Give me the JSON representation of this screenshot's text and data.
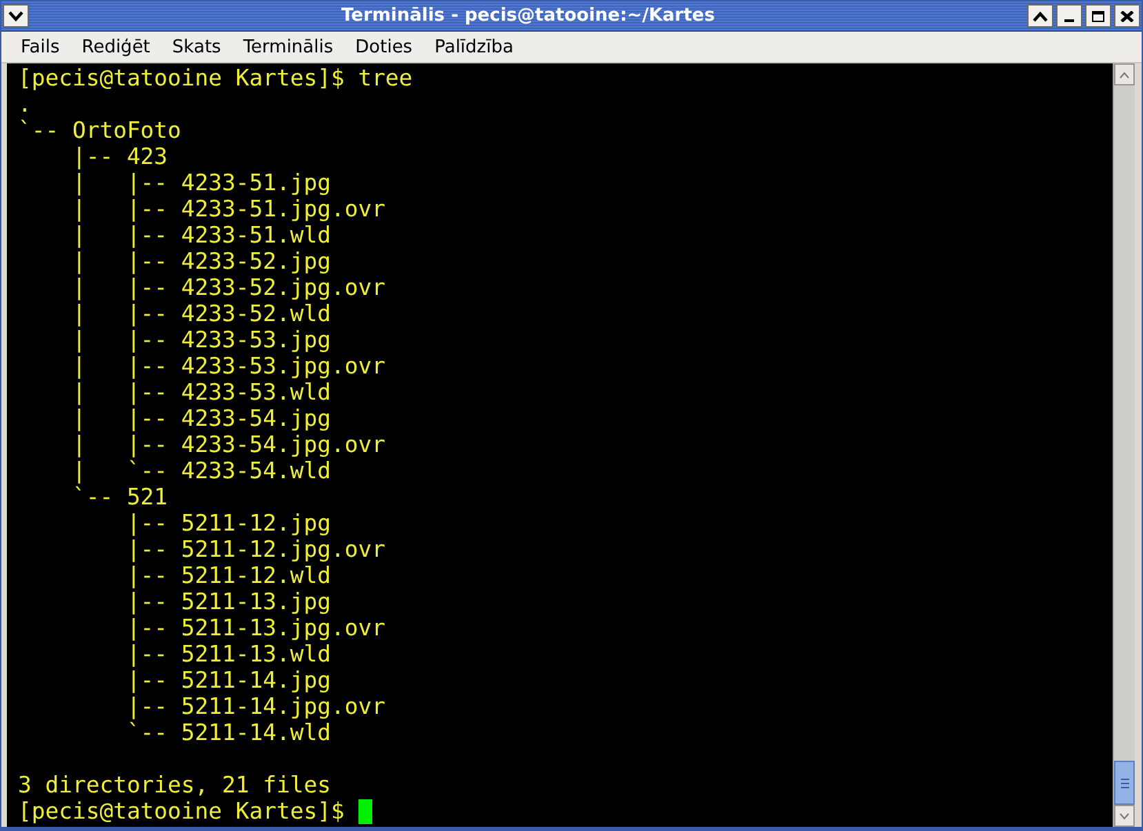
{
  "window": {
    "title": "Terminālis - pecis@tatooine:~/Kartes"
  },
  "menu": [
    "Fails",
    "Rediģēt",
    "Skats",
    "Terminālis",
    "Doties",
    "Palīdzība"
  ],
  "terminal": {
    "lines": [
      {
        "kind": "text",
        "text": "[pecis@tatooine Kartes]$ tree"
      },
      {
        "kind": "text",
        "text": "."
      },
      {
        "kind": "text",
        "text": "`-- OrtoFoto"
      },
      {
        "kind": "text",
        "text": "    |-- 423"
      },
      {
        "kind": "text",
        "text": "    |   |-- 4233-51.jpg"
      },
      {
        "kind": "text",
        "text": "    |   |-- 4233-51.jpg.ovr"
      },
      {
        "kind": "text",
        "text": "    |   |-- 4233-51.wld"
      },
      {
        "kind": "text",
        "text": "    |   |-- 4233-52.jpg"
      },
      {
        "kind": "text",
        "text": "    |   |-- 4233-52.jpg.ovr"
      },
      {
        "kind": "text",
        "text": "    |   |-- 4233-52.wld"
      },
      {
        "kind": "text",
        "text": "    |   |-- 4233-53.jpg"
      },
      {
        "kind": "text",
        "text": "    |   |-- 4233-53.jpg.ovr"
      },
      {
        "kind": "text",
        "text": "    |   |-- 4233-53.wld"
      },
      {
        "kind": "text",
        "text": "    |   |-- 4233-54.jpg"
      },
      {
        "kind": "text",
        "text": "    |   |-- 4233-54.jpg.ovr"
      },
      {
        "kind": "text",
        "text": "    |   `-- 4233-54.wld"
      },
      {
        "kind": "text",
        "text": "    `-- 521"
      },
      {
        "kind": "text",
        "text": "        |-- 5211-12.jpg"
      },
      {
        "kind": "text",
        "text": "        |-- 5211-12.jpg.ovr"
      },
      {
        "kind": "text",
        "text": "        |-- 5211-12.wld"
      },
      {
        "kind": "text",
        "text": "        |-- 5211-13.jpg"
      },
      {
        "kind": "text",
        "text": "        |-- 5211-13.jpg.ovr"
      },
      {
        "kind": "text",
        "text": "        |-- 5211-13.wld"
      },
      {
        "kind": "text",
        "text": "        |-- 5211-14.jpg"
      },
      {
        "kind": "text",
        "text": "        |-- 5211-14.jpg.ovr"
      },
      {
        "kind": "text",
        "text": "        `-- 5211-14.wld"
      },
      {
        "kind": "blank"
      },
      {
        "kind": "text",
        "text": "3 directories, 21 files"
      },
      {
        "kind": "prompt",
        "text": "[pecis@tatooine Kartes]$",
        "cursor": true
      }
    ]
  }
}
